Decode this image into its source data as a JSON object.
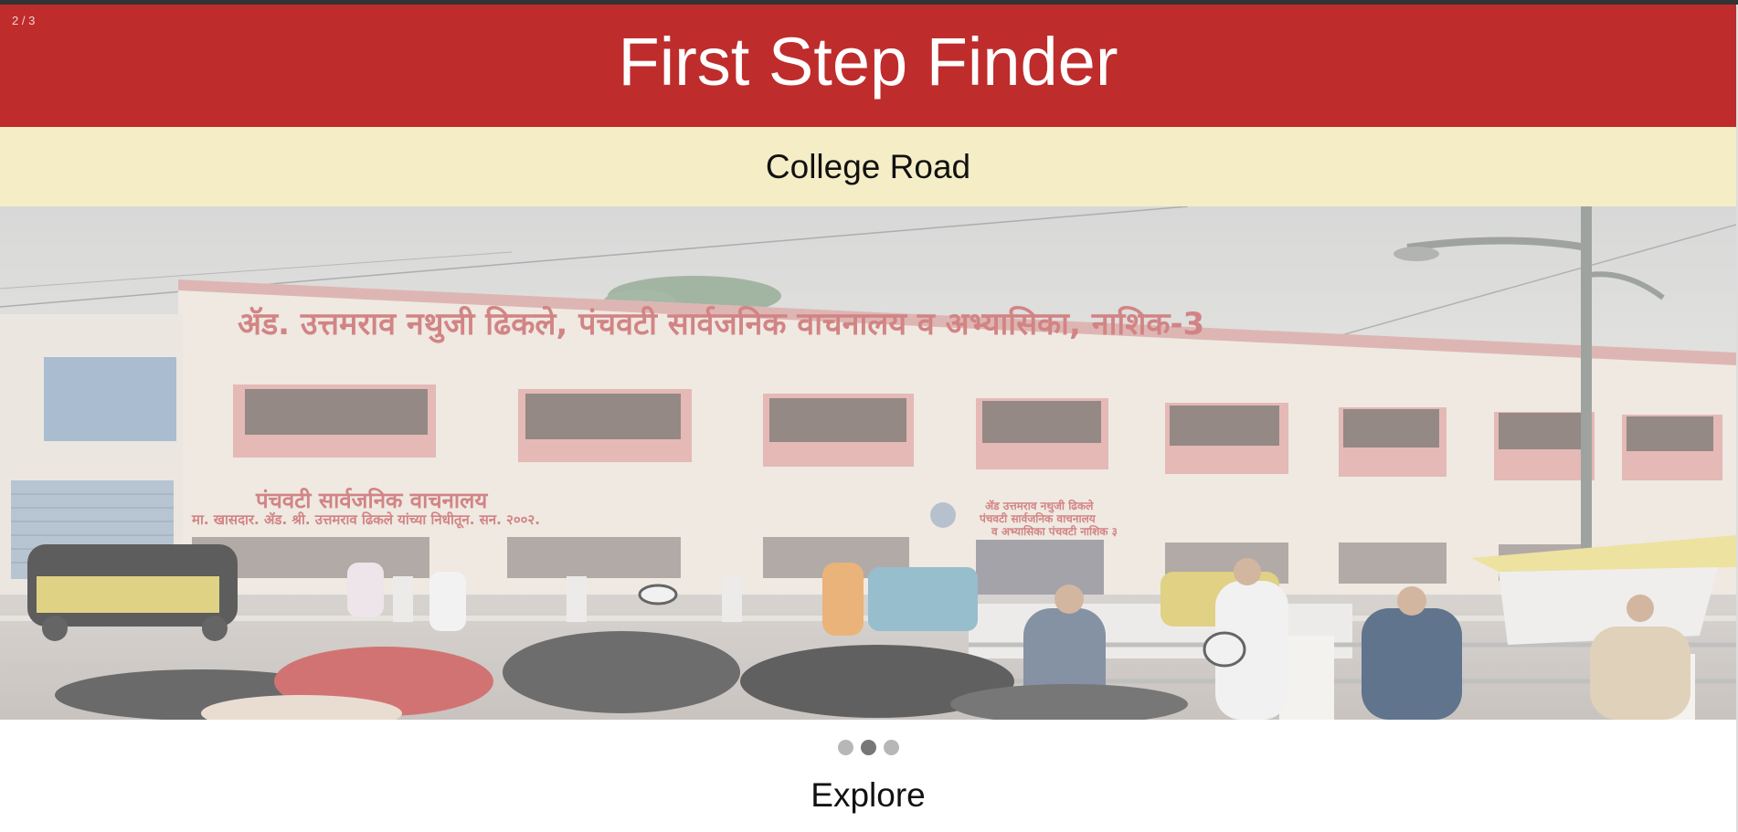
{
  "slider": {
    "counter": "2 / 3",
    "total_slides": 3,
    "active_index": 1,
    "dots": [
      "slide-1",
      "slide-2",
      "slide-3"
    ]
  },
  "header": {
    "title": "First Step Finder"
  },
  "location": {
    "name": "College Road"
  },
  "photo": {
    "sign_main": "ॲड. उत्तमराव नथुजी ढिकले, पंचवटी सार्वजनिक वाचनालय व अभ्यासिका, नाशिक-3",
    "sign_left_1": "पंचवटी सार्वजनिक वाचनालय",
    "sign_left_2": "मा. खासदार. ॲड. श्री. उत्तमराव ढिकले यांच्या निधीतून. सन. २००२.",
    "plaque_1": "ॲड उत्तमराव नथुजी ढिकले",
    "plaque_2": "पंचवटी सार्वजनिक वाचनालय",
    "plaque_3": "व अभ्यासिका पंचवटी नाशिक ३"
  },
  "footer": {
    "explore_label": "Explore"
  },
  "colors": {
    "header_bg": "#bf2c2c",
    "location_bg": "#f4edc6",
    "dot_inactive": "#b7b7b7",
    "dot_active": "#777777"
  }
}
